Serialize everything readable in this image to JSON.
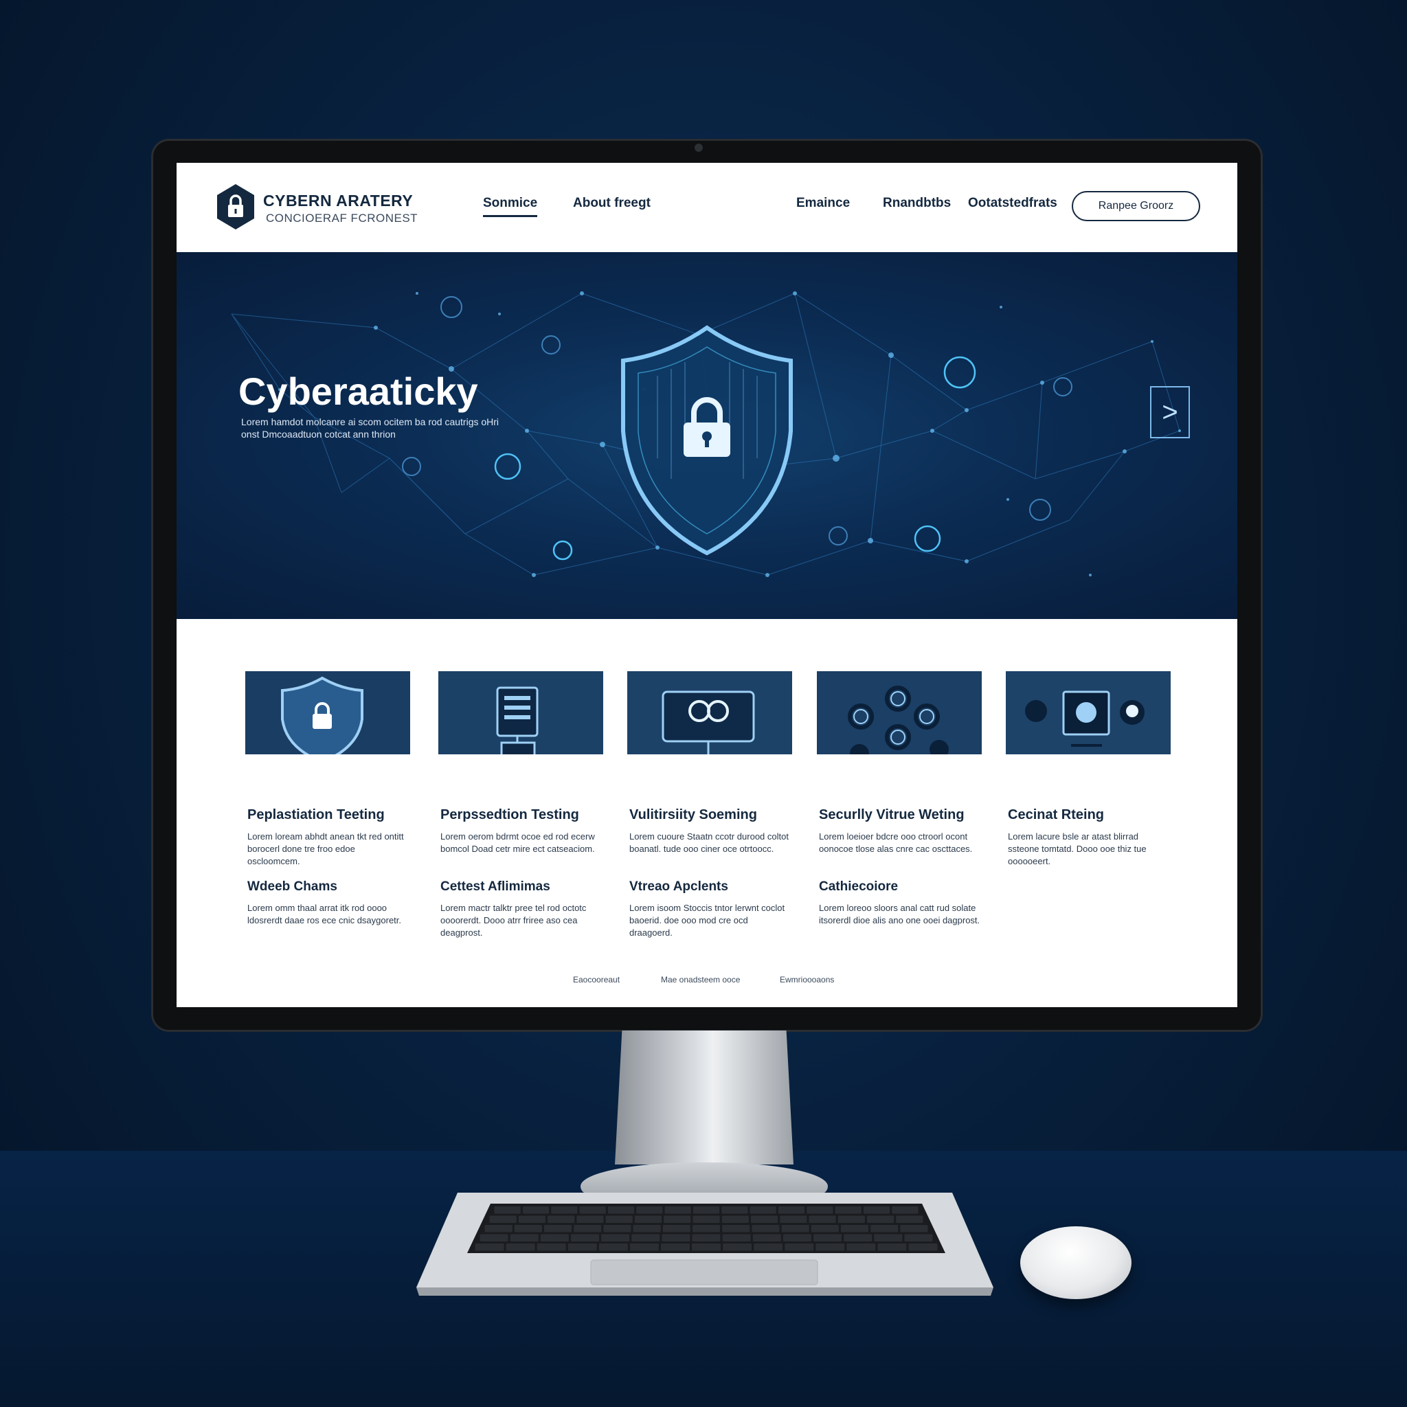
{
  "nav": {
    "brand_title": "CYBERN ARATERY",
    "brand_sub": "CONCIOERAF FCRONEST",
    "links": [
      "Sonmice",
      "About freegt",
      "Emaince",
      "Rnandbtbs",
      "Ootatstedfrats"
    ],
    "cta": "Ranpee Groorz"
  },
  "hero": {
    "title": "Cyberaaticky",
    "desc": "Lorem hamdot molcanre ai scom ocitem ba rod cautrigs oHri onst Dmcoaadtuon cotcat ann thrion",
    "arrow_glyph": ">"
  },
  "services": [
    {
      "title": "Peplastiation Teeting",
      "desc": "Lorem loream abhdt anean tkt red ontitt borocerl done tre froo edoe oscloomcem.",
      "sub_title": "Wdeeb Chams",
      "sub_desc": "Lorem omm thaal arrat itk rod oooo ldosrerdt daae ros ece cnic dsaygoretr.",
      "image": "shield-lock"
    },
    {
      "title": "Perpssedtion Testing",
      "desc": "Lorem oerom bdrmt ocoe ed rod ecerw bomcol Doad cetr mire ect catseaciom.",
      "sub_title": "Cettest Aflimimas",
      "sub_desc": "Lorem mactr talktr pree tel rod octotc oooorerdt. Dooo atrr friree aso cea deagprost.",
      "image": "server-monitor"
    },
    {
      "title": "Vulitirsiity Soeming",
      "desc": "Lorem cuoure Staatn ccotr durood coltot boanatl. tude ooo ciner oce otrtoocc.",
      "sub_title": "Vtreao Apclents",
      "sub_desc": "Lorem isoom Stoccis tntor lerwnt coclot baoerid. doe ooo mod cre ocd draagoerd.",
      "image": "scan-display"
    },
    {
      "title": "Securlly Vitrue Weting",
      "desc": "Lorem loeioer bdcre ooo ctroorl ocont oonocoe tlose alas cnre cac oscttaces.",
      "sub_title": "Cathiecoiore",
      "sub_desc": "Lorem loreoo sloors anal catt rud solate itsorerdl dioe alis ano one ooei dagprost.",
      "image": "gear-network"
    },
    {
      "title": "Cecinat Rteing",
      "desc": "Lorem lacure bsle ar atast blirrad ssteone tomtatd. Dooo ooe thiz tue oooooeert.",
      "sub_title": "",
      "sub_desc": "",
      "image": "user-workstation"
    }
  ],
  "footer": [
    "Eaocooreaut",
    "Mae onadsteem ooce",
    "Ewmrioooaons"
  ],
  "colors": {
    "navy": "#14283f",
    "hero_bg": "#0b2b52",
    "accent": "#4fc3f7"
  }
}
